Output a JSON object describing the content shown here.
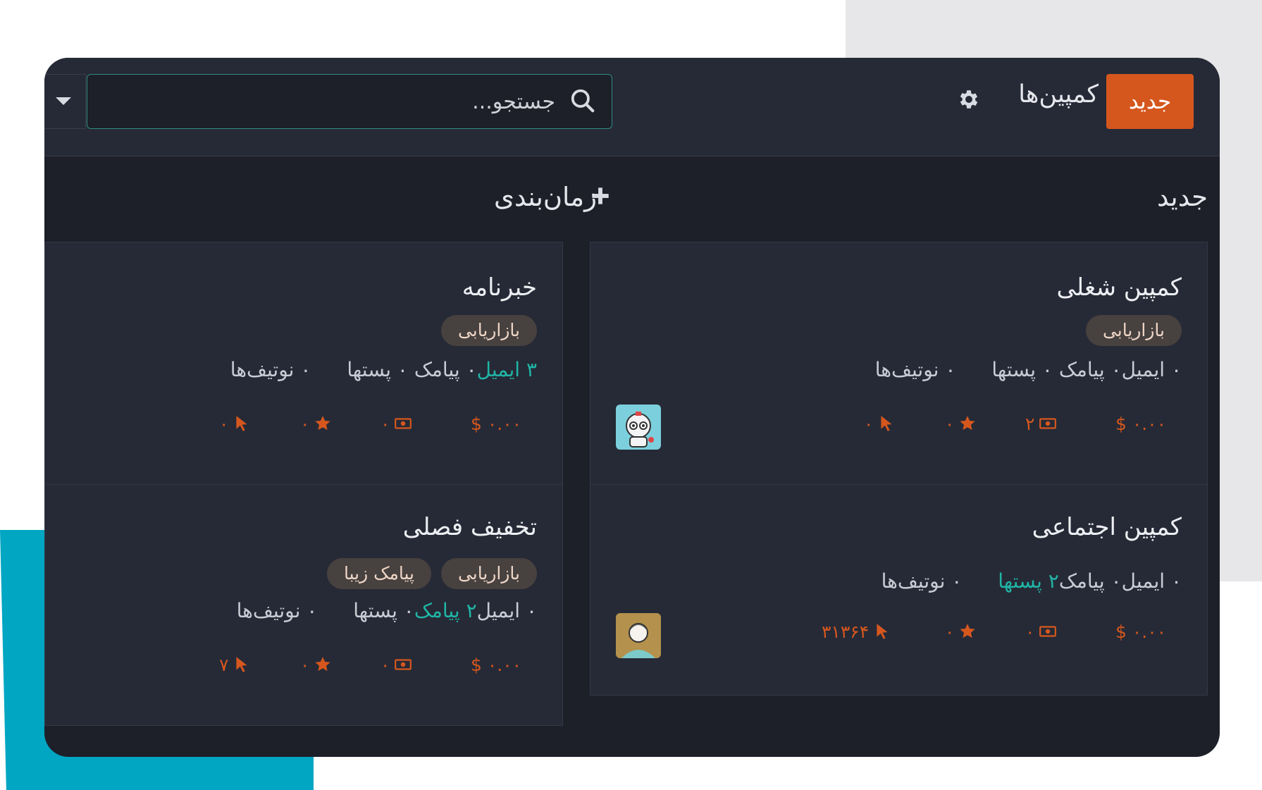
{
  "control_panel": {
    "new_button": "جدید",
    "title": "کمپین‌ها",
    "search_placeholder": "جستجو..."
  },
  "columns": [
    {
      "title": "جدید",
      "cards": [
        {
          "title": "کمپین شغلی",
          "tags": [
            "بازاریابی"
          ],
          "stats": {
            "email": "۰ ایمیل",
            "sms": "۰ پیامک",
            "posts": "۰ پستها",
            "notifications": "۰ نوتیف‌ها"
          },
          "kpis": {
            "revenue": "$ ۰.۰۰",
            "cash": "۲",
            "stars": "۰",
            "clicks": "۰"
          },
          "avatar": "robot-avatar"
        },
        {
          "title": "کمپین اجتماعی",
          "tags": [],
          "stats": {
            "email": "۰ ایمیل",
            "sms": "۰ پیامک",
            "posts": "۲ پستها",
            "notifications": "۰ نوتیف‌ها"
          },
          "kpis": {
            "revenue": "$ ۰.۰۰",
            "cash": "۰",
            "stars": "۰",
            "clicks": "۳۱۳۶۴"
          },
          "avatar": "person-avatar"
        }
      ]
    },
    {
      "title": "زمان‌بندی",
      "cards": [
        {
          "title": "خبرنامه",
          "tags": [
            "بازاریابی"
          ],
          "stats": {
            "email": "۳ ایمیل",
            "sms": "۰ پیامک",
            "posts": "۰ پستها",
            "notifications": "۰ نوتیف‌ها"
          },
          "kpis": {
            "revenue": "$ ۰.۰۰",
            "cash": "۰",
            "stars": "۰",
            "clicks": "۰"
          }
        },
        {
          "title": "تخفیف فصلی",
          "tags": [
            "بازاریابی",
            "پیامک زیبا"
          ],
          "stats": {
            "email": "۰ ایمیل",
            "sms": "۲ پیامک",
            "posts": "۰ پستها",
            "notifications": "۰ نوتیف‌ها"
          },
          "kpis": {
            "revenue": "$ ۰.۰۰",
            "cash": "۰",
            "stars": "۰",
            "clicks": "۷"
          }
        }
      ]
    }
  ],
  "colors": {
    "accent": "#d5571e",
    "highlight": "#20b5a6",
    "background": "#1d1f29",
    "card": "#262a36",
    "tag": "#47413f"
  },
  "icons": [
    "search-icon",
    "gear-icon",
    "plus-icon",
    "caret-down-icon",
    "cash-icon",
    "star-icon",
    "cursor-icon"
  ]
}
